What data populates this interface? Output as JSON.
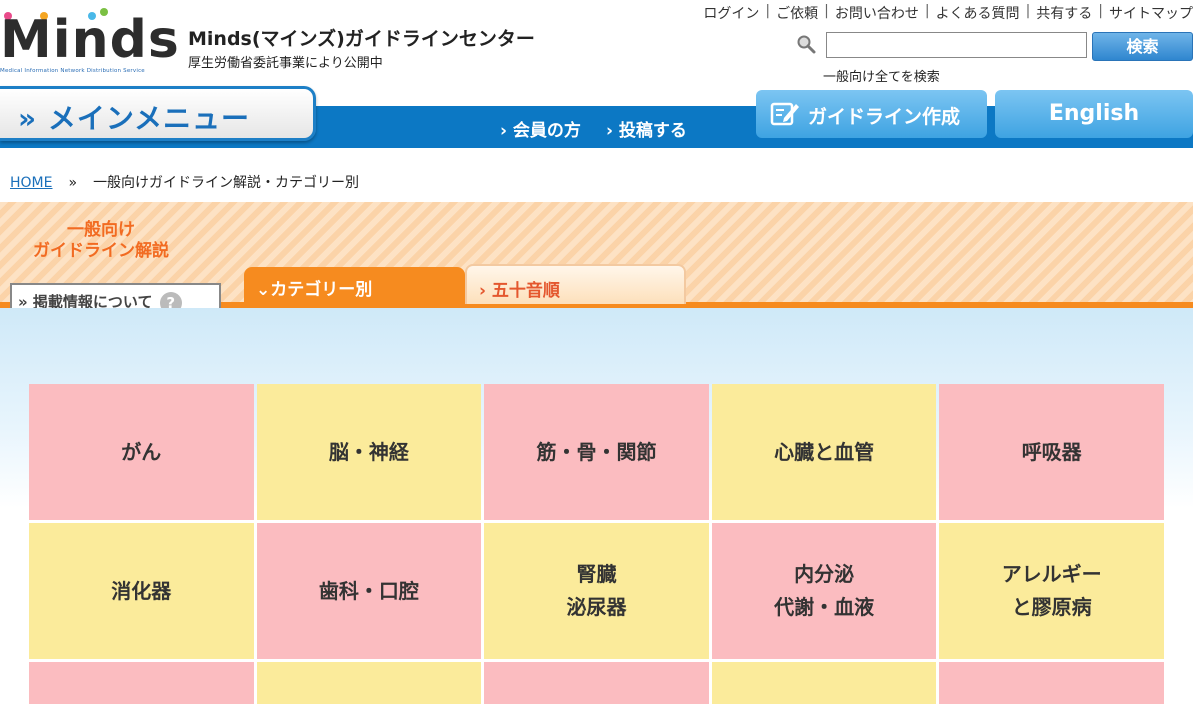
{
  "header": {
    "logo_text": "Minds",
    "logo_sub": "Medical Information Network Distribution Service",
    "title": "Minds(マインズ)ガイドラインセンター",
    "subtitle": "厚生労働省委託事業により公開中",
    "top_links": [
      "ログイン",
      "ご依頼",
      "お問い合わせ",
      "よくある質問",
      "共有する",
      "サイトマップ"
    ],
    "search": {
      "placeholder": "",
      "button": "検索",
      "note": "一般向け全てを検索"
    }
  },
  "menu": {
    "main_menu": "» メインメニュー",
    "links": [
      "› 会員の方",
      "› 投稿する"
    ],
    "guideline_btn": "ガイドライン作成",
    "english_btn": "English"
  },
  "breadcrumb": {
    "home": "HOME",
    "sep": "»",
    "current": "一般向けガイドライン解説・カテゴリー別"
  },
  "band": {
    "title_line1": "一般向け",
    "title_line2": "ガイドライン解説",
    "about": "» 掲載情報について",
    "about_icon": "?",
    "tab_category": "⌄カテゴリー別",
    "tab_syllabary": "› 五十音順"
  },
  "categories": [
    {
      "label": "がん",
      "color": "pink"
    },
    {
      "label": "脳・神経",
      "color": "yellow"
    },
    {
      "label": "筋・骨・関節",
      "color": "pink"
    },
    {
      "label": "心臓と血管",
      "color": "yellow"
    },
    {
      "label": "呼吸器",
      "color": "pink"
    },
    {
      "label": "消化器",
      "color": "yellow"
    },
    {
      "label": "歯科・口腔",
      "color": "pink"
    },
    {
      "label": "腎臓\n泌尿器",
      "color": "yellow"
    },
    {
      "label": "内分泌\n代謝・血液",
      "color": "pink"
    },
    {
      "label": "アレルギー\nと膠原病",
      "color": "yellow"
    },
    {
      "label": "",
      "color": "pink"
    },
    {
      "label": "",
      "color": "yellow"
    },
    {
      "label": "",
      "color": "pink"
    },
    {
      "label": "",
      "color": "yellow"
    },
    {
      "label": "",
      "color": "pink"
    }
  ],
  "colors": {
    "brand_blue": "#0c78c4",
    "accent_orange": "#f68b1f",
    "cell_pink": "#fbbcc0",
    "cell_yellow": "#fbeb9b"
  }
}
